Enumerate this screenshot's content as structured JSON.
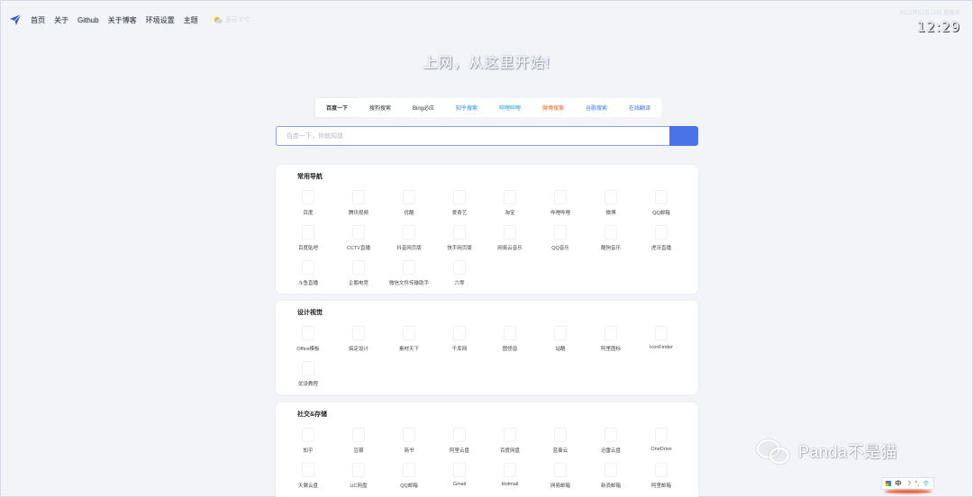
{
  "nav": {
    "links": [
      "首页",
      "关于",
      "Github",
      "关于博客",
      "环境设置",
      "主题"
    ],
    "weather": "多云 5°C"
  },
  "clock": {
    "date": "2023年02月10日 星期五",
    "time": "12:29"
  },
  "headline": "上网，从这里开始!",
  "engines": [
    {
      "label": "百度一下",
      "color": "#333333",
      "active": true
    },
    {
      "label": "搜狗搜索",
      "color": "#333333"
    },
    {
      "label": "Bing必应",
      "color": "#333333"
    },
    {
      "label": "知乎搜索",
      "color": "#1a8cff"
    },
    {
      "label": "哔哩哔哩",
      "color": "#20a0d8"
    },
    {
      "label": "微博搜索",
      "color": "#ff5a1f"
    },
    {
      "label": "谷歌搜索",
      "color": "#3a7bfd"
    },
    {
      "label": "在线翻译",
      "color": "#2f6ff0"
    }
  ],
  "search": {
    "placeholder": "百度一下，你就知道",
    "button_color": "#4b73e8"
  },
  "sections": [
    {
      "title": "常用导航",
      "items": [
        "百度",
        "腾讯视频",
        "优酷",
        "爱奇艺",
        "淘宝",
        "哔哩哔哩",
        "微博",
        "QQ邮箱",
        "百度贴吧",
        "CCTV直播",
        "抖音网页版",
        "快手网页版",
        "网易云音乐",
        "QQ音乐",
        "酷狗音乐",
        "虎牙直播",
        "斗鱼直播",
        "企鹅电竞",
        "微信文件传输助手",
        "六零"
      ]
    },
    {
      "title": "设计视觉",
      "items": [
        "Office模板",
        "搞定设计",
        "素材天下",
        "千库网",
        "图怪兽",
        "站酷",
        "阿里图标",
        "IconFinder",
        "优设教程"
      ]
    },
    {
      "title": "社交&存储",
      "items": [
        "知乎",
        "豆瓣",
        "简书",
        "阿里云盘",
        "百度网盘",
        "蓝奏云",
        "迅雷云盘",
        "OneDrive",
        "天翼云盘",
        "UC网盘",
        "QQ邮箱",
        "Gmail",
        "Hotmail",
        "网易邮箱",
        "新浪邮箱",
        "阿里邮箱"
      ]
    }
  ],
  "watermark": "Panda不是猫",
  "ime": {
    "lang": "中",
    "moon": "☽",
    "punct": "°,",
    "shirt": "👕"
  }
}
